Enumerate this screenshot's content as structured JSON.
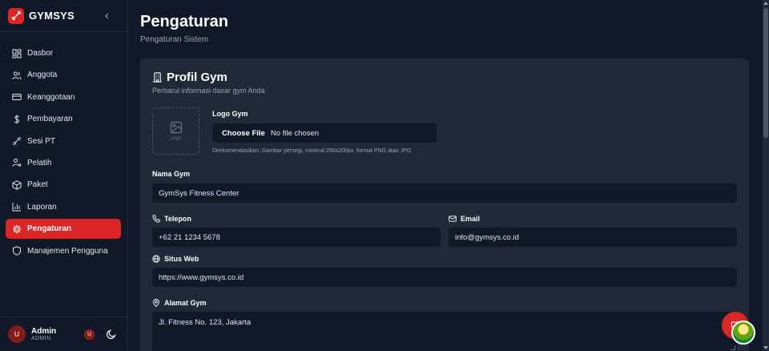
{
  "brand": {
    "name": "GYMSYS"
  },
  "sidebar": {
    "items": [
      {
        "label": "Dasbor",
        "icon": "dashboard-icon",
        "active": false
      },
      {
        "label": "Anggota",
        "icon": "users-icon",
        "active": false
      },
      {
        "label": "Keanggotaan",
        "icon": "card-icon",
        "active": false
      },
      {
        "label": "Pembayaran",
        "icon": "dollar-icon",
        "active": false
      },
      {
        "label": "Sesi PT",
        "icon": "dumbbell-icon",
        "active": false
      },
      {
        "label": "Pelatih",
        "icon": "trainer-icon",
        "active": false
      },
      {
        "label": "Paket",
        "icon": "package-icon",
        "active": false
      },
      {
        "label": "Laporan",
        "icon": "chart-icon",
        "active": false
      },
      {
        "label": "Pengaturan",
        "icon": "gear-icon",
        "active": true
      },
      {
        "label": "Manajemen Pengguna",
        "icon": "shield-icon",
        "active": false
      }
    ]
  },
  "user": {
    "initial": "U",
    "name": "Admin",
    "role": "ADMIN",
    "badge": "U"
  },
  "page": {
    "title": "Pengaturan",
    "subtitle": "Pengaturan Sistem"
  },
  "profile": {
    "title": "Profil Gym",
    "subtitle": "Perbarui informasi dasar gym Anda",
    "logo_placeholder": "Logo",
    "logo_label": "Logo Gym",
    "file_button": "Choose File",
    "file_status": "No file chosen",
    "file_hint": "Direkomendasikan: Gambar persegi, minimal 200x200px, format PNG atau JPG",
    "name_label": "Nama Gym",
    "name_value": "GymSys Fitness Center",
    "phone_label": "Telepon",
    "phone_value": "+62 21 1234 5678",
    "email_label": "Email",
    "email_value": "info@gymsys.co.id",
    "website_label": "Situs Web",
    "website_value": "https://www.gymsys.co.id",
    "address_label": "Alamat Gym",
    "address_value": "Jl. Fitness No. 123, Jakarta"
  },
  "colors": {
    "accent": "#dc2626",
    "background": "#111827",
    "card": "#1f2937"
  }
}
